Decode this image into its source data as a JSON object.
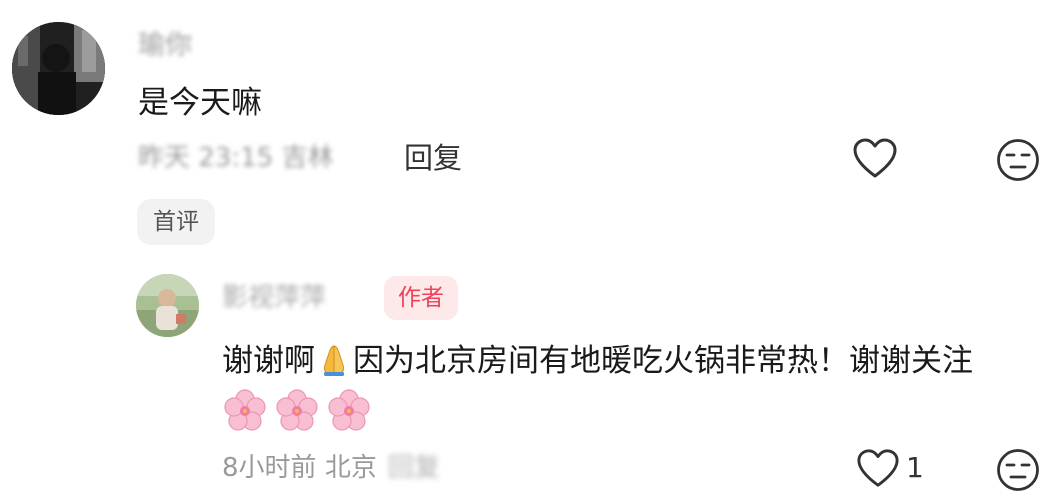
{
  "comment": {
    "username": "瑜你",
    "text": "是今天嘛",
    "time": "昨天 23:15",
    "location": "吉林",
    "reply_label": "回复",
    "badge": "首评"
  },
  "reply": {
    "username": "影视萍萍",
    "author_badge": "作者",
    "text_part1": "谢谢啊",
    "text_part2": "因为北京房间有地暖吃火锅非常热！谢谢关注",
    "time": "8小时前",
    "location": "北京",
    "reply_label": "回复",
    "like_count": "1"
  },
  "colors": {
    "author_badge_bg": "#fde8ea",
    "author_badge_text": "#f0405a",
    "meta_gray": "#9a9a9a"
  },
  "icons": {
    "like": "heart-outline-icon",
    "dislike": "neutral-face-icon",
    "pray": "folded-hands-emoji",
    "blossom": "cherry-blossom-emoji"
  }
}
